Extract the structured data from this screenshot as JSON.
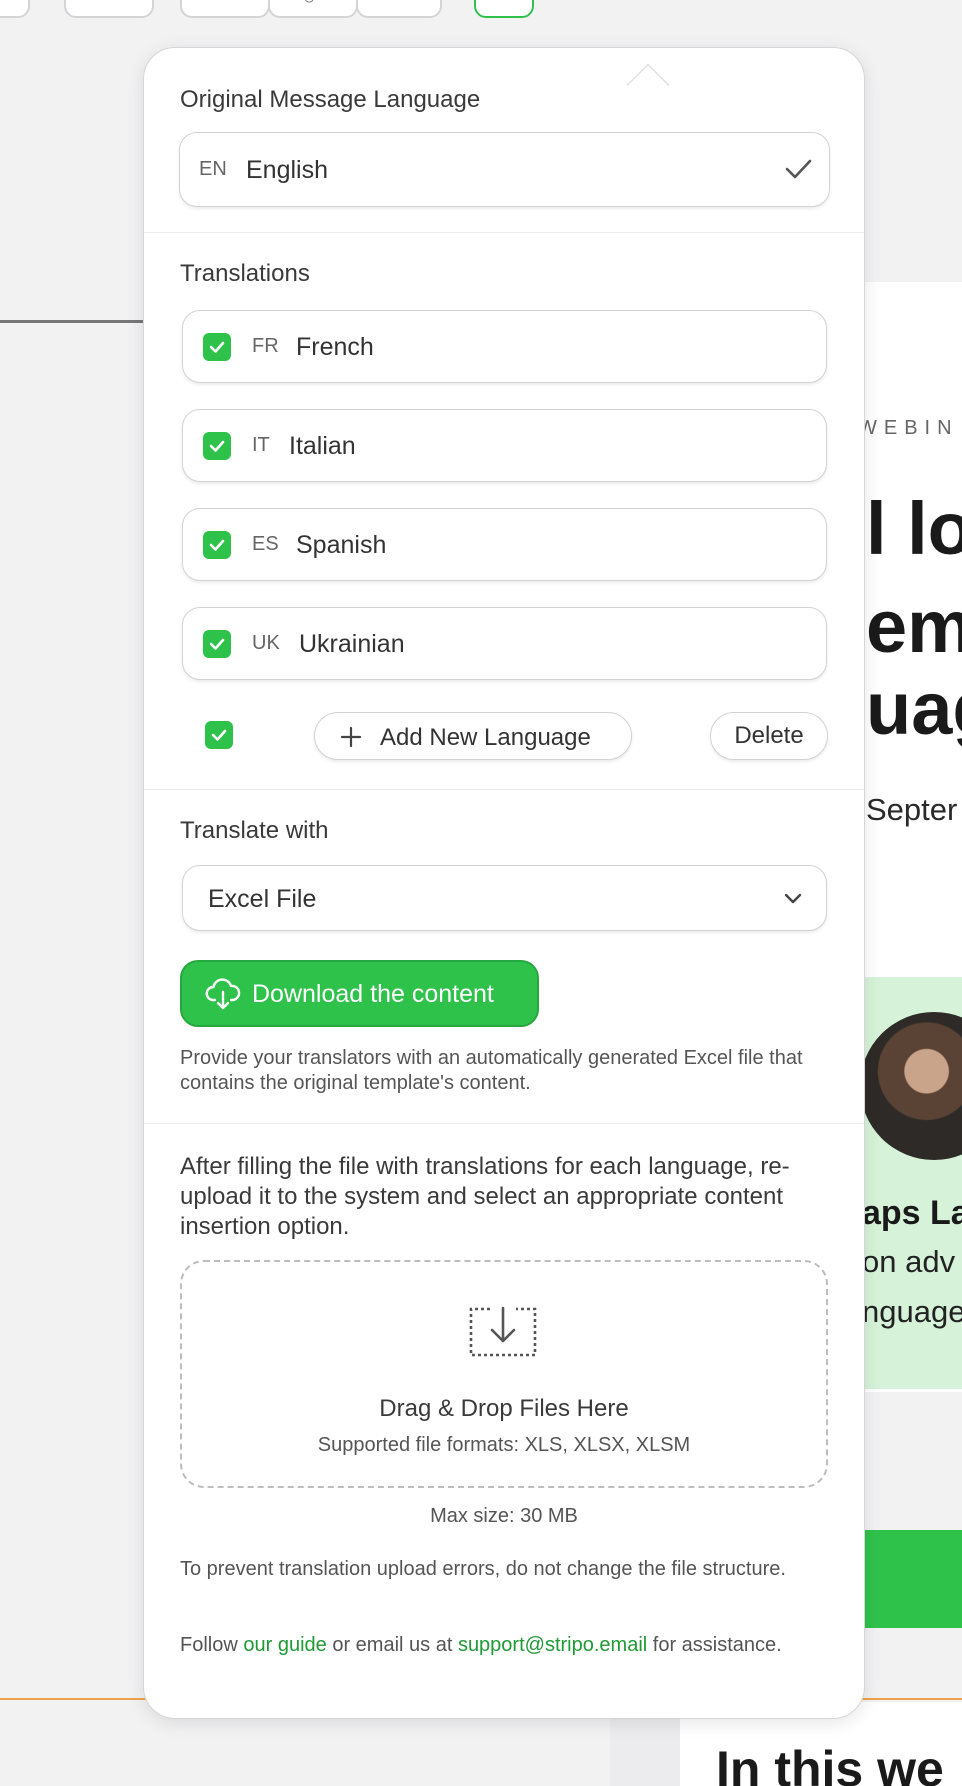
{
  "popover": {
    "original_language": {
      "label": "Original Message Language",
      "code": "EN",
      "name": "English"
    },
    "translations": {
      "label": "Translations",
      "items": [
        {
          "code": "FR",
          "name": "French",
          "checked": true
        },
        {
          "code": "IT",
          "name": "Italian",
          "checked": true
        },
        {
          "code": "ES",
          "name": "Spanish",
          "checked": true
        },
        {
          "code": "UK",
          "name": "Ukrainian",
          "checked": true
        }
      ],
      "add_label": "Add New Language",
      "delete_label": "Delete"
    },
    "translate_with": {
      "label": "Translate with",
      "selected": "Excel File"
    },
    "download": {
      "label": "Download the content",
      "help": "Provide your translators with an automatically generated Excel file that contains the original template's content."
    },
    "upload": {
      "instructions": "After filling the file with translations for each language, re-upload it to the system and select an appropriate content insertion option.",
      "dropzone_title": "Drag & Drop Files Here",
      "dropzone_formats": "Supported file formats: XLS, XLSX, XLSM",
      "max_size": "Max size: 30 MB",
      "warning": "To prevent translation upload errors, do not change the file structure.",
      "follow_prefix": "Follow ",
      "guide_link": "our guide",
      "follow_middle": " or email us at ",
      "email_link": "support@stripo.email",
      "follow_suffix": " for assistance."
    }
  },
  "background": {
    "eyebrow": "WEBIN",
    "hero_lines": [
      "l loc",
      "em",
      "uag"
    ],
    "date": "Septer",
    "speaker_name": "aps La",
    "speaker_desc": [
      "on adv",
      "nguage"
    ],
    "bottom_heading": "In this we"
  },
  "colors": {
    "accent": "#2fc24b",
    "link": "#1f9a35",
    "border": "#d2d2d4"
  }
}
